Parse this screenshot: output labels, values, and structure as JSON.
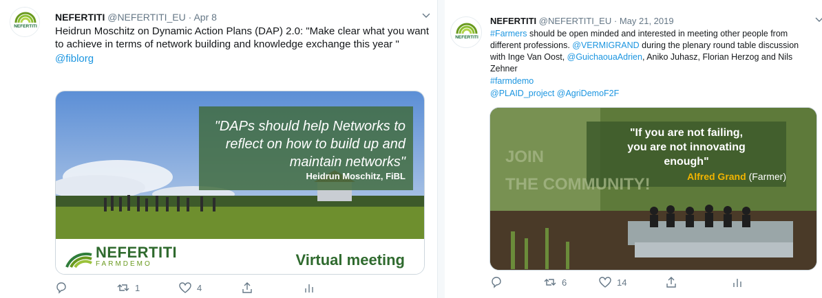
{
  "colors": {
    "link": "#1b95e0",
    "muted": "#657786",
    "brand_green": "#6a9a1f"
  },
  "tweet1": {
    "author": {
      "name": "NEFERTITI",
      "handle": "@NEFERTITI_EU",
      "sep": "·",
      "date": "Apr 8",
      "avatar_logo_text": "NEFERTITI"
    },
    "text": "Heidrun Moschitz on Dynamic Action Plans (DAP) 2.0: \"Make clear what you want to achieve in terms of network building and knowledge exchange this year \"",
    "mention": "@fiblorg",
    "media": {
      "quote_lines": [
        "\"DAPs should help Networks to",
        "reflect on how to build up and",
        "maintain networks\""
      ],
      "quote_author": "Heidrun Moschitz, FiBL",
      "logo_name": "NEFERTITI",
      "logo_sub": "FARMDEMO",
      "banner": "Virtual meeting"
    },
    "actions": {
      "reply_icon": "reply-icon",
      "retweet_icon": "retweet-icon",
      "retweets": "1",
      "like_icon": "like-icon",
      "likes": "4",
      "share_icon": "share-icon",
      "analytics_icon": "analytics-icon"
    }
  },
  "tweet2": {
    "author": {
      "name": "NEFERTITI",
      "handle": "@NEFERTITI_EU",
      "sep": "·",
      "date": "May 21, 2019"
    },
    "text_parts": {
      "hashtag1": "#Farmers",
      "t1": " should be open minded and interested in meeting other people from different professions. ",
      "mention1": "@VERMIGRAND",
      "t2": " during the plenary round table discussion with Inge Van Oost, ",
      "mention2": "@GuichaouaAdrien",
      "t3": ", Aniko Juhasz, Florian Herzog and Nils Zehner",
      "hashtag2": "#farmdemo",
      "mentions_line": "@PLAID_project @AgriDemoF2F"
    },
    "media": {
      "quote_lines": [
        "\"If you are not failing,",
        "you are not innovating",
        "enough\""
      ],
      "author_name": "Alfred Grand",
      "author_role": "(Farmer)",
      "wall_text_1": "JOIN",
      "wall_text_2": "THE COMMUNITY!"
    },
    "actions": {
      "retweets": "6",
      "likes": "14"
    }
  }
}
